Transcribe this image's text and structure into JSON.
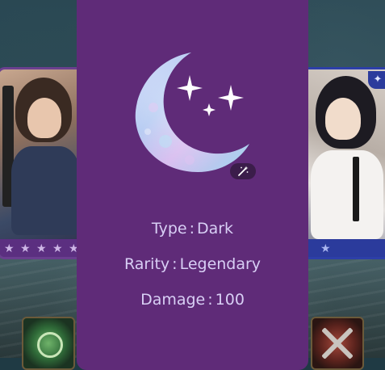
{
  "modal": {
    "icon": "crescent-moon-with-sparkles-icon",
    "edit_icon": "magic-wand-icon",
    "stats": [
      {
        "label": "Type",
        "value": "Dark"
      },
      {
        "label": "Rarity",
        "value": "Legendary"
      },
      {
        "label": "Damage",
        "value": "100"
      }
    ],
    "separator": ":"
  },
  "background": {
    "left_card": {
      "stars": 5,
      "frame_color": "#6a3f8f"
    },
    "right_card": {
      "stars": 1,
      "frame_color": "#2d3fa8",
      "badge_icon": "paw-icon"
    }
  },
  "colors": {
    "modal_bg": "#5f2b78",
    "text": "#d8cff5",
    "badge_bg": "#3b1d4a"
  }
}
